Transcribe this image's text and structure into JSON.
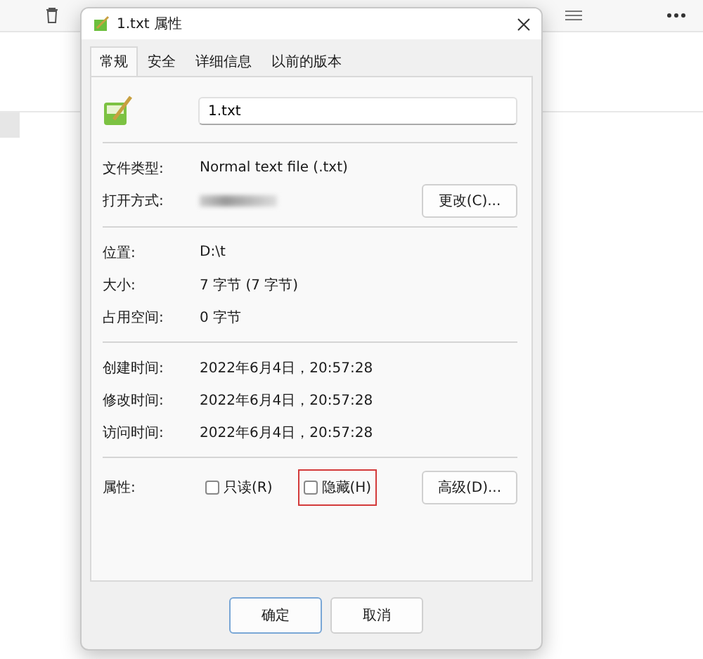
{
  "window": {
    "title": "1.txt 属性"
  },
  "tabs": [
    {
      "label": "常规",
      "selected": true
    },
    {
      "label": "安全",
      "selected": false
    },
    {
      "label": "详细信息",
      "selected": false
    },
    {
      "label": "以前的版本",
      "selected": false
    }
  ],
  "file_name": {
    "value": "1.txt"
  },
  "sections": [
    {
      "rows": [
        {
          "kind": "text",
          "label": "文件类型:",
          "value": "Normal text file (.txt)"
        },
        {
          "kind": "redacted",
          "label": "打开方式:",
          "button": "更改(C)..."
        }
      ]
    },
    {
      "rows": [
        {
          "kind": "text",
          "label": "位置:",
          "value": "D:\\t"
        },
        {
          "kind": "text",
          "label": "大小:",
          "value": "7 字节 (7 字节)"
        },
        {
          "kind": "text",
          "label": "占用空间:",
          "value": "0 字节"
        }
      ]
    },
    {
      "rows": [
        {
          "kind": "text",
          "label": "创建时间:",
          "value": "2022年6月4日，20:57:28"
        },
        {
          "kind": "text",
          "label": "修改时间:",
          "value": "2022年6月4日，20:57:28"
        },
        {
          "kind": "text",
          "label": "访问时间:",
          "value": "2022年6月4日，20:57:28"
        }
      ]
    }
  ],
  "attributes": {
    "label": "属性:",
    "checkboxes": [
      {
        "label": "只读(R)",
        "checked": false,
        "highlighted": false
      },
      {
        "label": "隐藏(H)",
        "checked": false,
        "highlighted": true
      }
    ],
    "button": "高级(D)..."
  },
  "buttons": [
    {
      "label": "确定",
      "default": true
    },
    {
      "label": "取消",
      "default": false
    }
  ]
}
